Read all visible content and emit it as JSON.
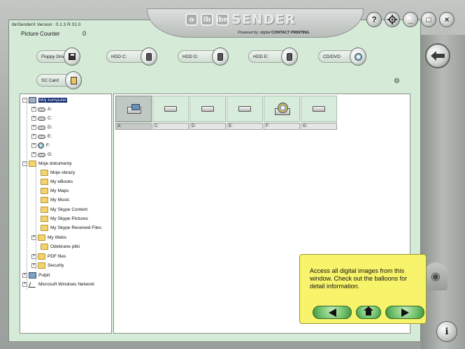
{
  "app": {
    "version": "lbnSenderX Version : 0.1.3 R 01.0",
    "logo_box_1": "o",
    "logo_box_2": "lb",
    "logo_box_3": "lbn",
    "logo_text": "SENDER",
    "powered_prefix": "Powered by: digital ",
    "powered_brand": "CONTACT PRINTING",
    "background_color": "#a9aeab",
    "workspace_color": "#d5ead7"
  },
  "window_controls": {
    "help": "?",
    "settings": "gear-icon",
    "minimize": "_",
    "maximize": "□",
    "close": "×"
  },
  "picture_counter": {
    "label": "Picture Counter",
    "value": "0"
  },
  "drives": [
    {
      "label": "Floppy Drive",
      "icon": "floppy-icon"
    },
    {
      "label": "HDD C:",
      "icon": "hdd-icon"
    },
    {
      "label": "HDD D:",
      "icon": "hdd-icon"
    },
    {
      "label": "HDD E:",
      "icon": "hdd-icon"
    },
    {
      "label": "CD/DVD",
      "icon": "cd-icon"
    },
    {
      "label": "SC Card",
      "icon": "sd-card-icon"
    }
  ],
  "tree": [
    {
      "label": "Mój komputer",
      "icon": "computer",
      "selected": true
    },
    {
      "label": "A:",
      "icon": "drive"
    },
    {
      "label": "C:",
      "icon": "drive"
    },
    {
      "label": "D:",
      "icon": "drive"
    },
    {
      "label": "E:",
      "icon": "drive"
    },
    {
      "label": "F:",
      "icon": "cd"
    },
    {
      "label": "G:",
      "icon": "drive"
    },
    {
      "label": "Moje dokumenty",
      "icon": "folder"
    },
    {
      "label": "Moje obrazy",
      "icon": "folder"
    },
    {
      "label": "My eBooks",
      "icon": "folder"
    },
    {
      "label": "My Maps",
      "icon": "folder"
    },
    {
      "label": "My Music",
      "icon": "folder"
    },
    {
      "label": "My Skype Content",
      "icon": "folder"
    },
    {
      "label": "My Skype Pictures",
      "icon": "folder"
    },
    {
      "label": "My Skype Received Files",
      "icon": "folder"
    },
    {
      "label": "My Webs",
      "icon": "folder"
    },
    {
      "label": "Odebrane pliki",
      "icon": "folder"
    },
    {
      "label": "PDF files",
      "icon": "folder"
    },
    {
      "label": "Security",
      "icon": "folder"
    },
    {
      "label": "Pulpit",
      "icon": "desktop"
    },
    {
      "label": "Microsoft Windows Network",
      "icon": "network"
    }
  ],
  "grid": [
    {
      "label": "A:",
      "icon": "floppy",
      "selected": true
    },
    {
      "label": "C:",
      "icon": "hdd"
    },
    {
      "label": "D:",
      "icon": "hdd"
    },
    {
      "label": "E:",
      "icon": "hdd"
    },
    {
      "label": "F:",
      "icon": "cd"
    },
    {
      "label": "G:",
      "icon": "hdd"
    }
  ],
  "balloon": {
    "text": "Access all digital images from this window. Check out the balloons for detail information.",
    "color": "#f7f36a",
    "nav_color": "#6fc06a"
  }
}
